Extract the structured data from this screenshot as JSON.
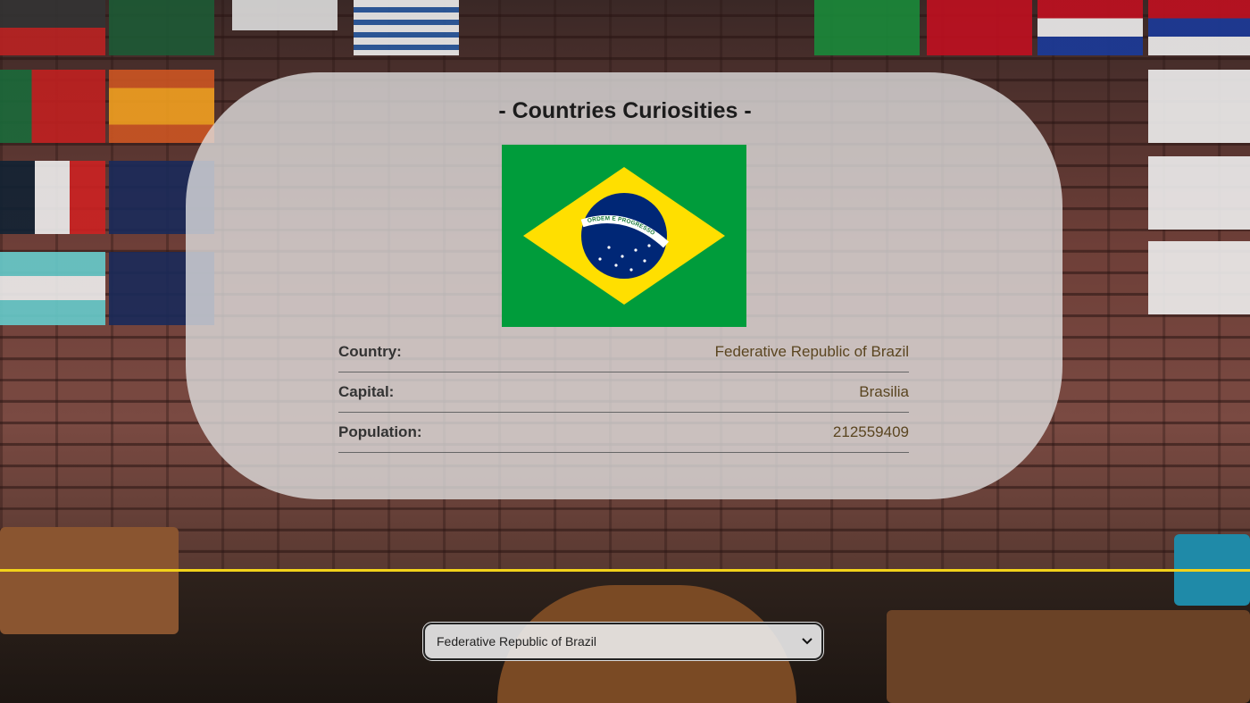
{
  "header": {
    "title": "- Countries Curiosities -"
  },
  "flag": {
    "country": "Brazil",
    "colors": {
      "green": "#009c3b",
      "yellow": "#ffdf00",
      "blue": "#002776"
    },
    "motto": "ORDEM E PROGRESSO"
  },
  "details": [
    {
      "label": "Country:",
      "value": "Federative Republic of Brazil"
    },
    {
      "label": "Capital:",
      "value": "Brasilia"
    },
    {
      "label": "Population:",
      "value": "212559409"
    }
  ],
  "country_select": {
    "selected": "Federative Republic of Brazil",
    "icon": "chevron-down-icon"
  },
  "accent_color": "#f2d21a"
}
